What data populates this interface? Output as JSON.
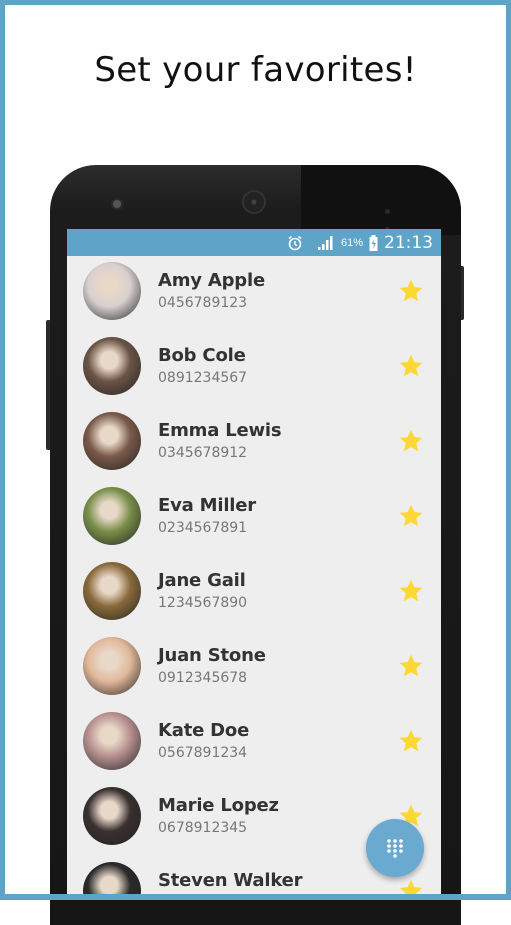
{
  "headline": "Set your favorites!",
  "status_bar": {
    "icons": [
      "alarm-icon",
      "signal-icon",
      "battery-charging-icon"
    ],
    "battery_percent": "61%",
    "time": "21:13"
  },
  "contacts": [
    {
      "name": "Amy Apple",
      "phone": "0456789123",
      "favorite": true,
      "avatar_color": "#d8cfcf"
    },
    {
      "name": "Bob Cole",
      "phone": "0891234567",
      "favorite": true,
      "avatar_color": "#6b5446"
    },
    {
      "name": "Emma Lewis",
      "phone": "0345678912",
      "favorite": true,
      "avatar_color": "#7a5a4a"
    },
    {
      "name": "Eva Miller",
      "phone": "0234567891",
      "favorite": true,
      "avatar_color": "#7a8f4a"
    },
    {
      "name": "Jane Gail",
      "phone": "1234567890",
      "favorite": true,
      "avatar_color": "#8a6a3a"
    },
    {
      "name": "Juan Stone",
      "phone": "0912345678",
      "favorite": true,
      "avatar_color": "#e2b89a"
    },
    {
      "name": "Kate Doe",
      "phone": "0567891234",
      "favorite": true,
      "avatar_color": "#b79090"
    },
    {
      "name": "Marie Lopez",
      "phone": "0678912345",
      "favorite": true,
      "avatar_color": "#3a3030"
    },
    {
      "name": "Steven Walker",
      "phone": "",
      "favorite": true,
      "avatar_color": "#2a2a2a"
    }
  ],
  "fab": {
    "icon": "dialpad-icon"
  },
  "colors": {
    "accent": "#5ea4c9",
    "star": "#fdd835",
    "fab": "#6aaad0"
  }
}
